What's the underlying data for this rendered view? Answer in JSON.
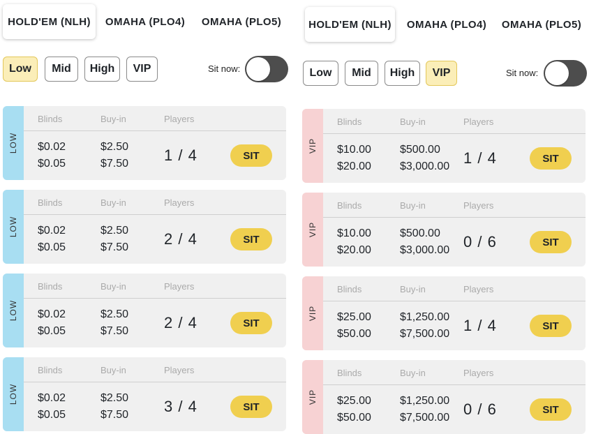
{
  "left": {
    "tabs": [
      "HOLD'EM (NLH)",
      "OMAHA (PLO4)",
      "OMAHA (PLO5)"
    ],
    "active_tab": 0,
    "filters": [
      "Low",
      "Mid",
      "High",
      "VIP"
    ],
    "active_filter": 0,
    "sit_now_label": "Sit now:",
    "sit_now_on": false,
    "columns": {
      "blinds": "Blinds",
      "buyin": "Buy-in",
      "players": "Players"
    },
    "sit_label": "SIT",
    "tables": [
      {
        "stake": "LOW",
        "blinds_small": "$0.02",
        "blinds_big": "$0.05",
        "buyin_min": "$2.50",
        "buyin_max": "$7.50",
        "players": "1 / 4"
      },
      {
        "stake": "LOW",
        "blinds_small": "$0.02",
        "blinds_big": "$0.05",
        "buyin_min": "$2.50",
        "buyin_max": "$7.50",
        "players": "2 / 4"
      },
      {
        "stake": "LOW",
        "blinds_small": "$0.02",
        "blinds_big": "$0.05",
        "buyin_min": "$2.50",
        "buyin_max": "$7.50",
        "players": "2 / 4"
      },
      {
        "stake": "LOW",
        "blinds_small": "$0.02",
        "blinds_big": "$0.05",
        "buyin_min": "$2.50",
        "buyin_max": "$7.50",
        "players": "3 / 4"
      }
    ]
  },
  "right": {
    "tabs": [
      "HOLD'EM (NLH)",
      "OMAHA (PLO4)",
      "OMAHA (PLO5)"
    ],
    "active_tab": 0,
    "filters": [
      "Low",
      "Mid",
      "High",
      "VIP"
    ],
    "active_filter": 3,
    "sit_now_label": "Sit now:",
    "sit_now_on": false,
    "columns": {
      "blinds": "Blinds",
      "buyin": "Buy-in",
      "players": "Players"
    },
    "sit_label": "SIT",
    "tables": [
      {
        "stake": "VIP",
        "blinds_small": "$10.00",
        "blinds_big": "$20.00",
        "buyin_min": "$500.00",
        "buyin_max": "$3,000.00",
        "players": "1 / 4"
      },
      {
        "stake": "VIP",
        "blinds_small": "$10.00",
        "blinds_big": "$20.00",
        "buyin_min": "$500.00",
        "buyin_max": "$3,000.00",
        "players": "0 / 6"
      },
      {
        "stake": "VIP",
        "blinds_small": "$25.00",
        "blinds_big": "$50.00",
        "buyin_min": "$1,250.00",
        "buyin_max": "$7,500.00",
        "players": "1 / 4"
      },
      {
        "stake": "VIP",
        "blinds_small": "$25.00",
        "blinds_big": "$50.00",
        "buyin_min": "$1,250.00",
        "buyin_max": "$7,500.00",
        "players": "0 / 6"
      }
    ]
  },
  "colors": {
    "low_stripe": "#a8def2",
    "vip_stripe": "#f7d2d3",
    "sit_button": "#f0cf4f",
    "active_filter": "#fbeeb8",
    "toggle_track": "#4d4d4d"
  }
}
